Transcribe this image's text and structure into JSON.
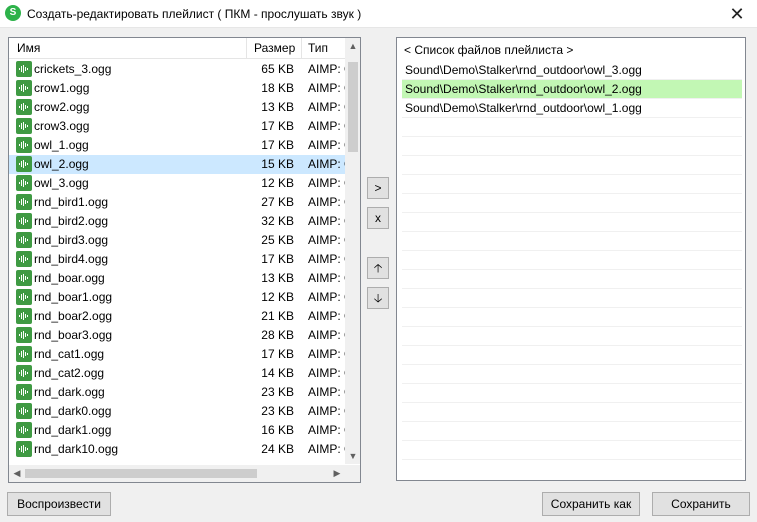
{
  "window": {
    "title": "Создать-редактировать плейлист ( ПКМ - прослушать звук )",
    "close_glyph": "✕"
  },
  "file_list": {
    "columns": {
      "name": "Имя",
      "size": "Размер",
      "type": "Тип"
    },
    "selected_index": 5,
    "rows": [
      {
        "name": "crickets_3.ogg",
        "size": "65 KB",
        "type": "AIMP: Ogg"
      },
      {
        "name": "crow1.ogg",
        "size": "18 KB",
        "type": "AIMP: Ogg"
      },
      {
        "name": "crow2.ogg",
        "size": "13 KB",
        "type": "AIMP: Ogg"
      },
      {
        "name": "crow3.ogg",
        "size": "17 KB",
        "type": "AIMP: Ogg"
      },
      {
        "name": "owl_1.ogg",
        "size": "17 KB",
        "type": "AIMP: Ogg"
      },
      {
        "name": "owl_2.ogg",
        "size": "15 KB",
        "type": "AIMP: Ogg"
      },
      {
        "name": "owl_3.ogg",
        "size": "12 KB",
        "type": "AIMP: Ogg"
      },
      {
        "name": "rnd_bird1.ogg",
        "size": "27 KB",
        "type": "AIMP: Ogg"
      },
      {
        "name": "rnd_bird2.ogg",
        "size": "32 KB",
        "type": "AIMP: Ogg"
      },
      {
        "name": "rnd_bird3.ogg",
        "size": "25 KB",
        "type": "AIMP: Ogg"
      },
      {
        "name": "rnd_bird4.ogg",
        "size": "17 KB",
        "type": "AIMP: Ogg"
      },
      {
        "name": "rnd_boar.ogg",
        "size": "13 KB",
        "type": "AIMP: Ogg"
      },
      {
        "name": "rnd_boar1.ogg",
        "size": "12 KB",
        "type": "AIMP: Ogg"
      },
      {
        "name": "rnd_boar2.ogg",
        "size": "21 KB",
        "type": "AIMP: Ogg"
      },
      {
        "name": "rnd_boar3.ogg",
        "size": "28 KB",
        "type": "AIMP: Ogg"
      },
      {
        "name": "rnd_cat1.ogg",
        "size": "17 KB",
        "type": "AIMP: Ogg"
      },
      {
        "name": "rnd_cat2.ogg",
        "size": "14 KB",
        "type": "AIMP: Ogg"
      },
      {
        "name": "rnd_dark.ogg",
        "size": "23 KB",
        "type": "AIMP: Ogg"
      },
      {
        "name": "rnd_dark0.ogg",
        "size": "23 KB",
        "type": "AIMP: Ogg"
      },
      {
        "name": "rnd_dark1.ogg",
        "size": "16 KB",
        "type": "AIMP: Ogg"
      },
      {
        "name": "rnd_dark10.ogg",
        "size": "24 KB",
        "type": "AIMP: Ogg"
      }
    ]
  },
  "middle_buttons": {
    "add": ">",
    "remove": "x",
    "up": "🡡",
    "down": "🡣"
  },
  "playlist": {
    "header": "< Список файлов плейлиста >",
    "highlighted_index": 1,
    "items": [
      "Sound\\Demo\\Stalker\\rnd_outdoor\\owl_3.ogg",
      "Sound\\Demo\\Stalker\\rnd_outdoor\\owl_2.ogg",
      "Sound\\Demo\\Stalker\\rnd_outdoor\\owl_1.ogg"
    ],
    "highlight_color": "#c2f7b4"
  },
  "bottom_buttons": {
    "play": "Воспроизвести",
    "save_as": "Сохранить как",
    "save": "Сохранить"
  },
  "colors": {
    "selection": "#cce8ff",
    "file_icon": "#3f9a43",
    "app_icon": "#2db24a"
  }
}
